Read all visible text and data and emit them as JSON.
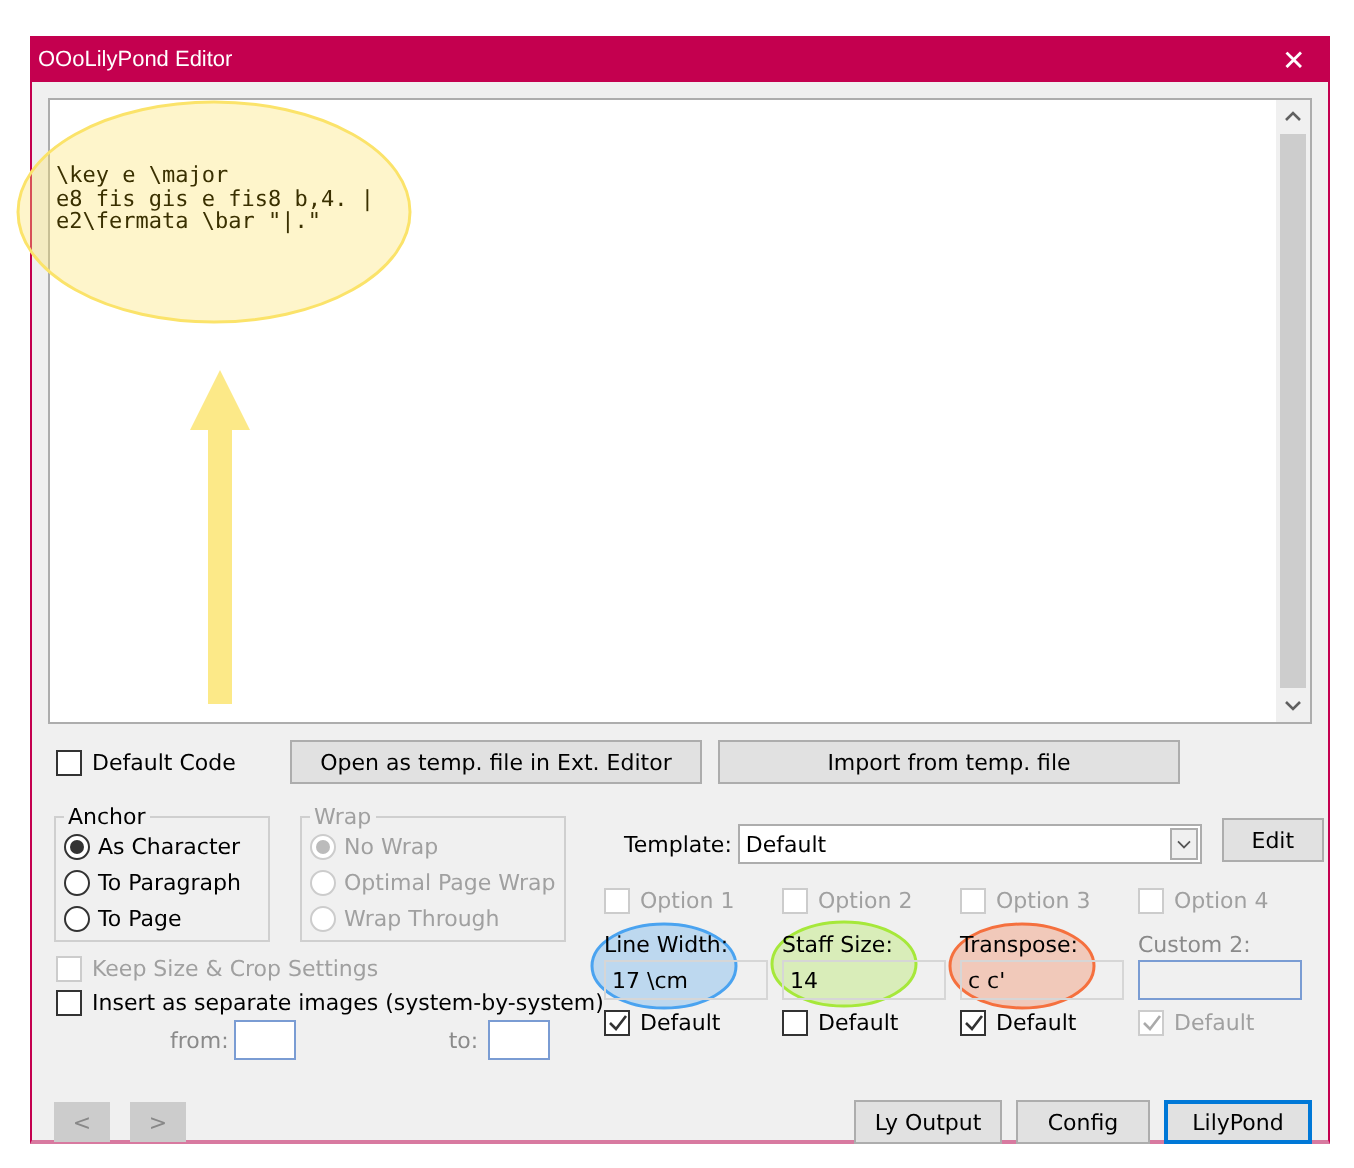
{
  "window": {
    "title": "OOoLilyPond Editor",
    "close": "✕"
  },
  "editor": {
    "lines": [
      "\\key e \\major",
      "e8 fis gis e fis8 b,4. |",
      "e2\\fermata \\bar \"|.\""
    ],
    "color": "#fbe36a"
  },
  "default_code": {
    "label": "Default Code",
    "checked": false
  },
  "top_buttons": [
    {
      "label": "Open as temp. file in Ext. Editor"
    },
    {
      "label": "Import from temp. file"
    }
  ],
  "anchor": {
    "title": "Anchor",
    "options": [
      {
        "label": "As Character",
        "selected": true
      },
      {
        "label": "To Paragraph",
        "selected": false
      },
      {
        "label": "To Page",
        "selected": false
      }
    ]
  },
  "wrap": {
    "title": "Wrap",
    "disabled": true,
    "options": [
      {
        "label": "No Wrap",
        "selected": true
      },
      {
        "label": "Optimal Page Wrap",
        "selected": false
      },
      {
        "label": "Wrap Through",
        "selected": false
      }
    ]
  },
  "keep_size": {
    "label": "Keep Size & Crop Settings",
    "checked": false,
    "disabled": true
  },
  "insert_separate": {
    "label": "Insert as separate images (system-by-system)",
    "checked": false
  },
  "from_label": "from:",
  "to_label": "to:",
  "template": {
    "label": "Template:",
    "value": "Default"
  },
  "edit_button": "Edit",
  "options": [
    {
      "option": "Option 1",
      "option_checked": false,
      "field_label": "Line Width:",
      "value": "17 \\cm",
      "default": "Default",
      "default_checked": true,
      "color": "#4aa3f0"
    },
    {
      "option": "Option 2",
      "option_checked": false,
      "field_label": "Staff Size:",
      "value": "14",
      "default": "Default",
      "default_checked": false,
      "color": "#a6e83a"
    },
    {
      "option": "Option 3",
      "option_checked": false,
      "field_label": "Transpose:",
      "value": "c c'",
      "default": "Default",
      "default_checked": true,
      "color": "#f5703e"
    },
    {
      "option": "Option 4",
      "option_checked": false,
      "field_label": "Custom 2:",
      "default": "Default",
      "default_checked": true,
      "disabled": true
    }
  ],
  "nav": [
    "<",
    ">"
  ],
  "bottom_buttons": [
    {
      "label": "Ly Output",
      "primary": false
    },
    {
      "label": "Config",
      "primary": false
    },
    {
      "label": "LilyPond",
      "primary": true
    }
  ]
}
